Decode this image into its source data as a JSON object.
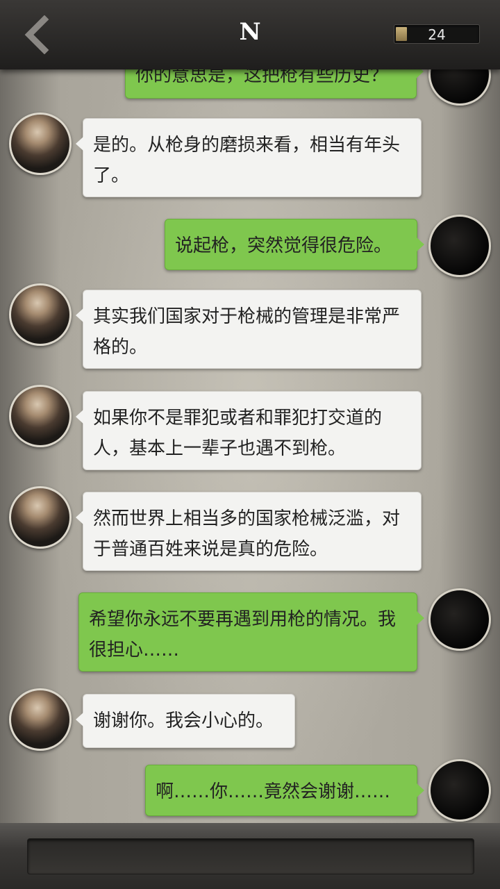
{
  "header": {
    "title": "N",
    "counter_value": "24",
    "back_icon": "chevron-left-icon"
  },
  "messages": [
    {
      "side": "right",
      "text": "你的意思是，这把枪有些历史？",
      "clipped": true
    },
    {
      "side": "left",
      "text": "是的。从枪身的磨损来看，相当有年头了。"
    },
    {
      "side": "right",
      "text": "说起枪，突然觉得很危险。"
    },
    {
      "side": "left",
      "text": "其实我们国家对于枪械的管理是非常严格的。"
    },
    {
      "side": "left",
      "text": "如果你不是罪犯或者和罪犯打交道的人，基本上一辈子也遇不到枪。"
    },
    {
      "side": "left",
      "text": "然而世界上相当多的国家枪械泛滥，对于普通百姓来说是真的危险。"
    },
    {
      "side": "right",
      "text": "希望你永远不要再遇到用枪的情况。我很担心……"
    },
    {
      "side": "left",
      "text": "谢谢你。我会小心的。"
    },
    {
      "side": "right",
      "text": "啊……你……竟然会谢谢……"
    }
  ],
  "colors": {
    "incoming_bubble": "#f3f3f1",
    "outgoing_bubble": "#7fc74e",
    "topbar": "#2b2a28"
  }
}
